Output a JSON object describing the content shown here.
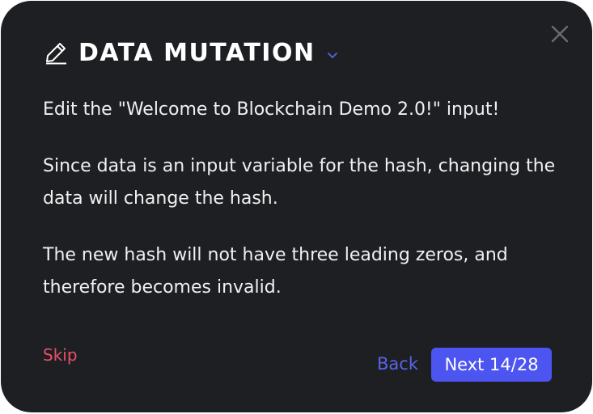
{
  "header": {
    "title": "DATA MUTATION",
    "icon": "pencil-icon"
  },
  "body": {
    "paragraphs": [
      "Edit the \"Welcome to Blockchain Demo 2.0!\" input!",
      "Since data is an input variable for the hash, changing the data will change the hash.",
      "The new hash will not have three leading zeros, and therefore becomes invalid."
    ]
  },
  "footer": {
    "skip_label": "Skip",
    "back_label": "Back",
    "next_label": "Next 14/28"
  },
  "colors": {
    "background": "#1e1f23",
    "accent": "#4d55f0",
    "skip": "#e8506a",
    "back": "#5b63ea"
  }
}
